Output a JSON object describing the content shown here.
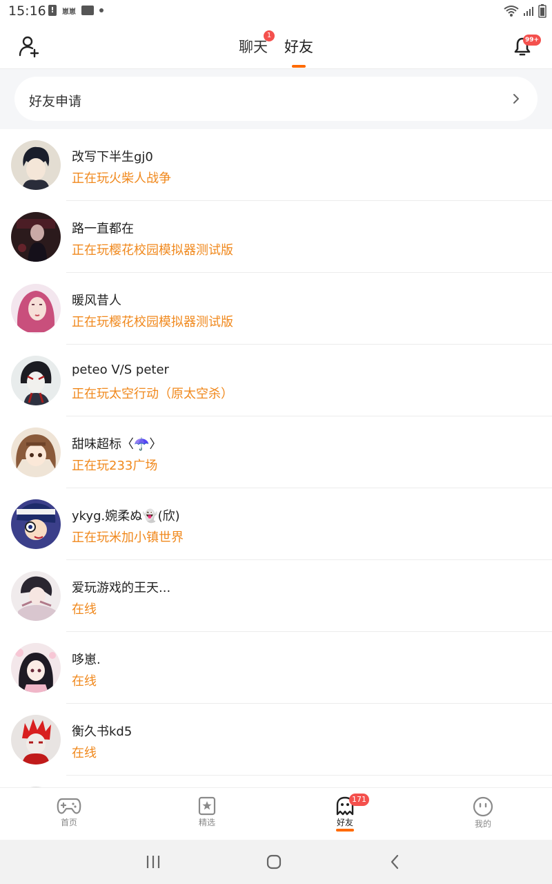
{
  "status_bar": {
    "time": "15:16",
    "notif_text": "崽崽"
  },
  "header": {
    "tabs": [
      {
        "label": "聊天",
        "badge": "1"
      },
      {
        "label": "好友"
      }
    ],
    "bell_badge": "99+"
  },
  "request_banner": {
    "label": "好友申请"
  },
  "friends": [
    {
      "name": "改写下半生gj0",
      "status": "正在玩火柴人战争"
    },
    {
      "name": "路一直都在",
      "status": "正在玩樱花校园模拟器测试版"
    },
    {
      "name": "暖风昔人",
      "status": "正在玩樱花校园模拟器测试版"
    },
    {
      "name": "peteo V/S peter",
      "status": "正在玩太空行动（原太空杀）"
    },
    {
      "name": "甜味超标〈☂️〉",
      "status": "正在玩233广场"
    },
    {
      "name": "ykyg.婉柔ぬ👻(欣)",
      "status": "正在玩米加小镇世界"
    },
    {
      "name": "爱玩游戏的王天...",
      "status": "在线"
    },
    {
      "name": "哆崽.",
      "status": "在线"
    },
    {
      "name": "衡久书kd5",
      "status": "在线"
    }
  ],
  "bottom_nav": [
    {
      "label": "首页",
      "icon": "gamepad-icon"
    },
    {
      "label": "精选",
      "icon": "star-bookmark-icon"
    },
    {
      "label": "好友",
      "icon": "ghost-icon",
      "badge": "171"
    },
    {
      "label": "我的",
      "icon": "smiley-face-icon"
    }
  ],
  "colors": {
    "accent": "#ff6a00",
    "status_text": "#f0881c",
    "badge": "#f4504d"
  }
}
